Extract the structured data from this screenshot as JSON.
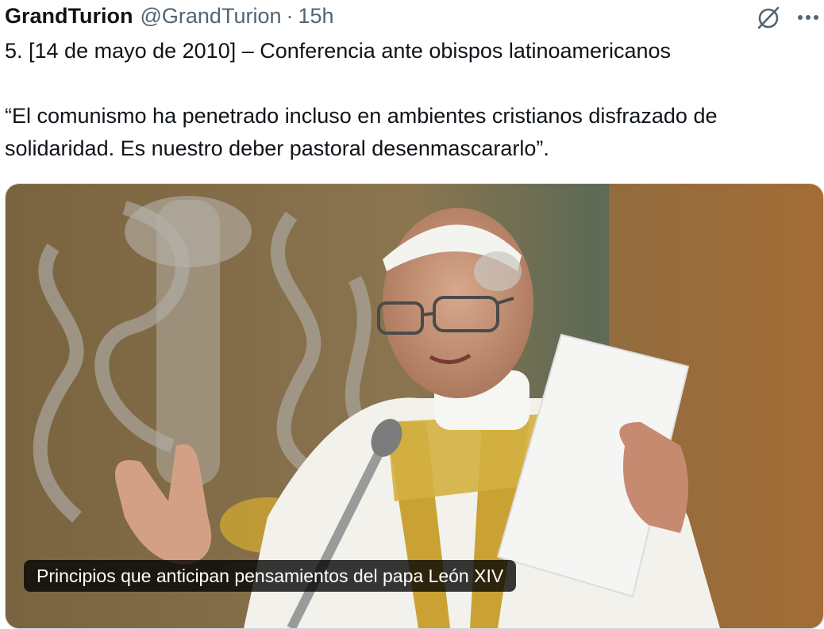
{
  "tweet": {
    "display_name": "GrandTurion",
    "handle": "@GrandTurion",
    "separator": "·",
    "time": "15h",
    "text_line_1": "5. [14 de mayo de 2010] – Conferencia ante obispos latinoamericanos",
    "text_line_2": "“El comunismo ha penetrado incluso en ambientes cristianos disfrazado de",
    "text_line_3": "solidaridad. Es nuestro deber pastoral desenmascararlo”.",
    "media_caption": "Principios que anticipan pensamientos del papa León XIV"
  },
  "icons": {
    "grok": "grok-icon",
    "more": "more-options-icon"
  },
  "colors": {
    "text": "#0f1419",
    "secondary": "#536471",
    "caption_bg": "#000000"
  }
}
